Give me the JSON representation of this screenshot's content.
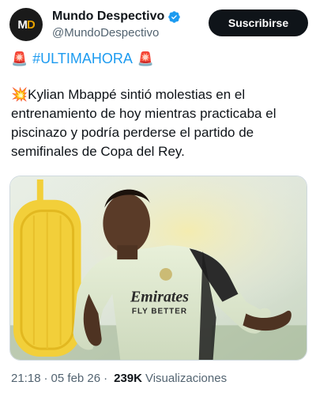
{
  "account": {
    "avatar_text": "MD",
    "display_name": "Mundo Despectivo",
    "handle": "@MundoDespectivo",
    "verified": true
  },
  "subscribe_label": "Suscribirse",
  "post": {
    "hashtag_prefix_icon": "🚨",
    "hashtag": "#ULTIMAHORA",
    "hashtag_suffix_icon": "🚨",
    "text_icon": "💥",
    "text": "Kylian Mbappé sintió molestias en el entrenamiento de hoy mientras practicaba el piscinazo y podría perderse el partido de semifinales de Copa del Rey.",
    "image": {
      "description_icon": "photo-player-training",
      "shirt_text_line1": "Emirates",
      "shirt_text_line2": "FLY BETTER"
    }
  },
  "meta": {
    "time": "21:18",
    "separator": "·",
    "date": "05 feb 26",
    "views_count": "239K",
    "views_label": "Visualizaciones"
  },
  "colors": {
    "accent": "#1d9bf0",
    "verified": "#1d9bf0",
    "subscribe_bg": "#0f1419",
    "text": "#0f1419",
    "muted": "#536471",
    "brand_yellow": "#e8a200"
  }
}
